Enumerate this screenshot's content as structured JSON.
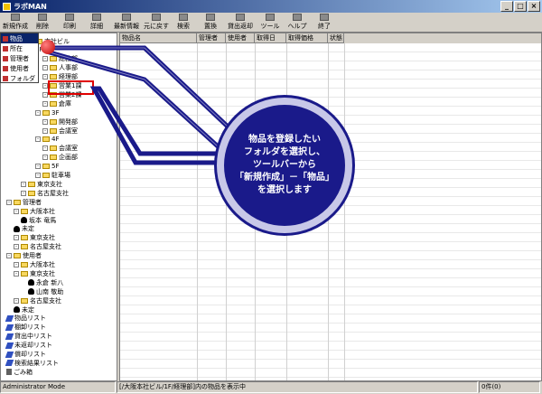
{
  "window": {
    "title": "ラボMAN"
  },
  "toolbar": [
    {
      "label": "新規作成"
    },
    {
      "label": "削除"
    },
    {
      "label": "印刷"
    },
    {
      "label": "詳細"
    },
    {
      "label": "最新情報"
    },
    {
      "label": "元に戻す"
    },
    {
      "label": "検索"
    },
    {
      "label": "置換"
    },
    {
      "label": "貸出返却"
    },
    {
      "label": "ツール"
    },
    {
      "label": "ヘルプ"
    },
    {
      "label": "終了"
    }
  ],
  "popup": [
    {
      "label": "物品"
    },
    {
      "label": "所在"
    },
    {
      "label": "管理者"
    },
    {
      "label": "使用者"
    },
    {
      "label": "フォルダ"
    }
  ],
  "tree": [
    {
      "label": "本社ビル",
      "indent": 3,
      "icon": "folder"
    },
    {
      "label": "1F",
      "indent": 4,
      "icon": "none"
    },
    {
      "label": "総務部",
      "indent": 5,
      "icon": "folder"
    },
    {
      "label": "人事部",
      "indent": 5,
      "icon": "folder"
    },
    {
      "label": "経理部",
      "indent": 5,
      "icon": "folder"
    },
    {
      "label": "営業1課",
      "indent": 5,
      "icon": "folder"
    },
    {
      "label": "営業2課",
      "indent": 5,
      "icon": "folder"
    },
    {
      "label": "倉庫",
      "indent": 5,
      "icon": "folder"
    },
    {
      "label": "3F",
      "indent": 4,
      "icon": "folder"
    },
    {
      "label": "開発部",
      "indent": 5,
      "icon": "folder"
    },
    {
      "label": "会議室",
      "indent": 5,
      "icon": "folder"
    },
    {
      "label": "4F",
      "indent": 4,
      "icon": "folder"
    },
    {
      "label": "会議室",
      "indent": 5,
      "icon": "folder"
    },
    {
      "label": "企画部",
      "indent": 5,
      "icon": "folder"
    },
    {
      "label": "5F",
      "indent": 4,
      "icon": "folder"
    },
    {
      "label": "駐車場",
      "indent": 4,
      "icon": "folder"
    },
    {
      "label": "東京支社",
      "indent": 2,
      "icon": "folder"
    },
    {
      "label": "名古屋支社",
      "indent": 2,
      "icon": "folder"
    },
    {
      "label": "管理者",
      "indent": 0,
      "icon": "folder"
    },
    {
      "label": "大阪本社",
      "indent": 1,
      "icon": "folder"
    },
    {
      "label": "坂本 竜馬",
      "indent": 2,
      "icon": "person"
    },
    {
      "label": "未定",
      "indent": 1,
      "icon": "person"
    },
    {
      "label": "東京支社",
      "indent": 1,
      "icon": "folder"
    },
    {
      "label": "名古屋支社",
      "indent": 1,
      "icon": "folder"
    },
    {
      "label": "使用者",
      "indent": 0,
      "icon": "folder"
    },
    {
      "label": "大阪本社",
      "indent": 1,
      "icon": "folder"
    },
    {
      "label": "東京支社",
      "indent": 1,
      "icon": "folder"
    },
    {
      "label": "永倉 新八",
      "indent": 3,
      "icon": "person"
    },
    {
      "label": "山南 敬助",
      "indent": 3,
      "icon": "person"
    },
    {
      "label": "名古屋支社",
      "indent": 1,
      "icon": "folder"
    },
    {
      "label": "未定",
      "indent": 1,
      "icon": "person"
    },
    {
      "label": "物品リスト",
      "indent": 0,
      "icon": "list"
    },
    {
      "label": "棚卸リスト",
      "indent": 0,
      "icon": "list"
    },
    {
      "label": "貸出中リスト",
      "indent": 0,
      "icon": "list"
    },
    {
      "label": "未返却リスト",
      "indent": 0,
      "icon": "list"
    },
    {
      "label": "償却リスト",
      "indent": 0,
      "icon": "list"
    },
    {
      "label": "検索結果リスト",
      "indent": 0,
      "icon": "list"
    },
    {
      "label": "ごみ箱",
      "indent": 0,
      "icon": "trash"
    }
  ],
  "columns": [
    {
      "label": "物品名"
    },
    {
      "label": "管理者"
    },
    {
      "label": "使用者"
    },
    {
      "label": "取得日"
    },
    {
      "label": "取得価格"
    },
    {
      "label": "状態"
    }
  ],
  "status": {
    "mode": "Administrator Mode",
    "path": "[/大阪本社ビル/1F/経理部]内の物品を表示中",
    "count": "0件(0)"
  },
  "callout": {
    "text": "物品を登録したい\nフォルダを選択し、\nツールバーから\n「新規作成」－「物品」\nを選択します"
  }
}
